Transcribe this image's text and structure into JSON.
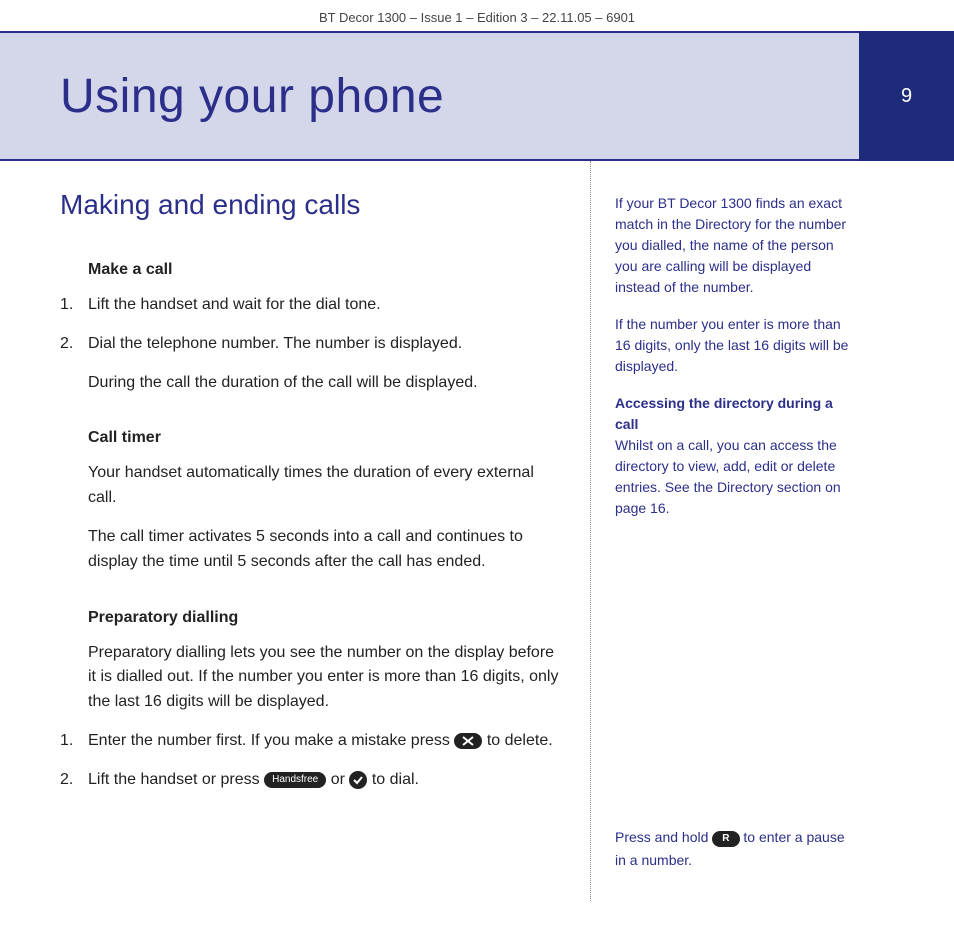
{
  "header": "BT Decor 1300 – Issue 1 – Edition 3 – 22.11.05 – 6901",
  "page_number": "9",
  "title": "Using your phone",
  "section_title": "Making and ending calls",
  "make_call": {
    "heading": "Make a call",
    "step1": "Lift the handset and wait for the dial tone.",
    "step2": "Dial the telephone number. The number is displayed.",
    "note": "During the call the duration of the call will be displayed."
  },
  "call_timer": {
    "heading": "Call timer",
    "p1": "Your handset automatically times the duration of every external call.",
    "p2": "The call timer activates 5 seconds into a call and continues to display the time until 5 seconds after the call has ended."
  },
  "prep_dial": {
    "heading": "Preparatory dialling",
    "intro": "Preparatory dialling lets you see the number on the display before it is dialled out. If the number you enter is more than 16 digits, only the last 16 digits will be displayed.",
    "step1a": "Enter the number first. If you make a mistake press ",
    "step1b": " to delete.",
    "step2a": "Lift the handset or press ",
    "step2b": " or ",
    "step2c": " to dial."
  },
  "icons": {
    "delete": "✕",
    "handsfree": "Handsfree",
    "dial": "✓",
    "r_key": "R"
  },
  "sidebar": {
    "p1": "If your BT Decor 1300 finds an exact match in the Directory for the number you dialled, the name of the person you are calling will be displayed instead of the number.",
    "p2": "If the number you enter is more than 16 digits, only the last 16 digits will be displayed.",
    "h3": "Accessing the directory during a call",
    "p3": "Whilst on a call, you can access the directory to view, add, edit or delete entries. See the Directory section on page 16.",
    "bottom_a": "Press and hold ",
    "bottom_b": " to enter a pause in a number."
  }
}
